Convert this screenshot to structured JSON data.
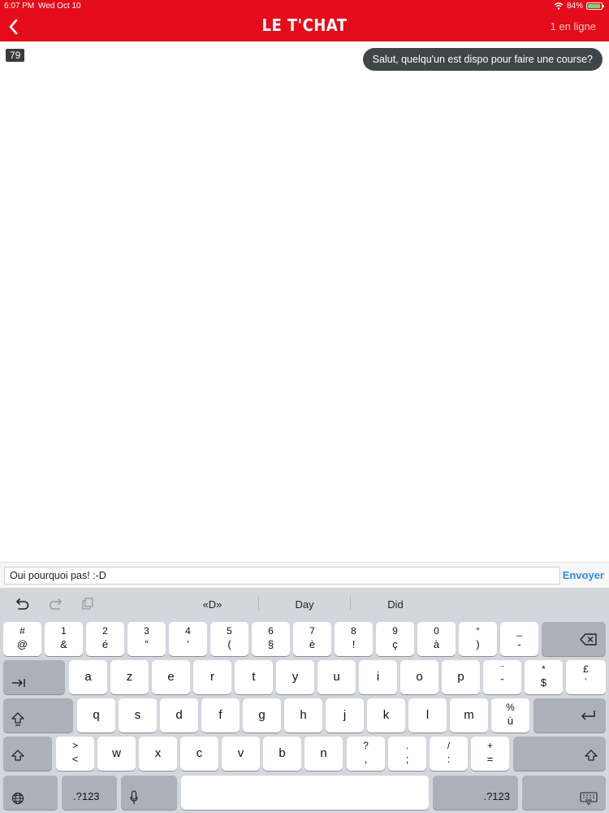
{
  "status_bar": {
    "time": "6:07 PM",
    "date": "Wed Oct 10",
    "battery": "84%"
  },
  "header": {
    "title": "LE T'CHAT",
    "online": "1 en ligne"
  },
  "chat": {
    "user_count": "79",
    "messages": [
      {
        "text": "Salut, quelqu'un est dispo pour faire une course?"
      }
    ]
  },
  "composer": {
    "value": "Oui pourquoi pas! :-D",
    "send_label": "Envoyer"
  },
  "keyboard": {
    "suggestions": [
      "«D»",
      "Day",
      "Did"
    ],
    "row1": [
      {
        "top": "#",
        "bot": "@"
      },
      {
        "top": "1",
        "bot": "&"
      },
      {
        "top": "2",
        "bot": "é"
      },
      {
        "top": "3",
        "bot": "”"
      },
      {
        "top": "4",
        "bot": "’"
      },
      {
        "top": "5",
        "bot": "("
      },
      {
        "top": "6",
        "bot": "§"
      },
      {
        "top": "7",
        "bot": "è"
      },
      {
        "top": "8",
        "bot": "!"
      },
      {
        "top": "9",
        "bot": "ç"
      },
      {
        "top": "0",
        "bot": "à"
      },
      {
        "top": "°",
        "bot": ")"
      },
      {
        "top": "_",
        "bot": "-"
      }
    ],
    "row2": [
      "a",
      "z",
      "e",
      "r",
      "t",
      "y",
      "u",
      "i",
      "o",
      "p"
    ],
    "row2_extra": [
      {
        "top": "¨",
        "bot": "ˆ"
      },
      {
        "top": "*",
        "bot": "$"
      },
      {
        "top": "£",
        "bot": "`"
      }
    ],
    "row3": [
      "q",
      "s",
      "d",
      "f",
      "g",
      "h",
      "j",
      "k",
      "l",
      "m"
    ],
    "row3_extra": {
      "top": "%",
      "bot": "ù"
    },
    "row4": [
      "w",
      "x",
      "c",
      "v",
      "b",
      "n"
    ],
    "row4_extra": [
      {
        "top": ">",
        "bot": "<"
      },
      {
        "top": "?",
        "bot": ","
      },
      {
        "top": ".",
        "bot": ";"
      },
      {
        "top": "/",
        "bot": ":"
      },
      {
        "top": "+",
        "bot": "="
      }
    ],
    "numbers_label": ".?123"
  },
  "colors": {
    "brand": "#e40b1a",
    "send": "#2f8de0",
    "bubble": "#3e4648"
  }
}
